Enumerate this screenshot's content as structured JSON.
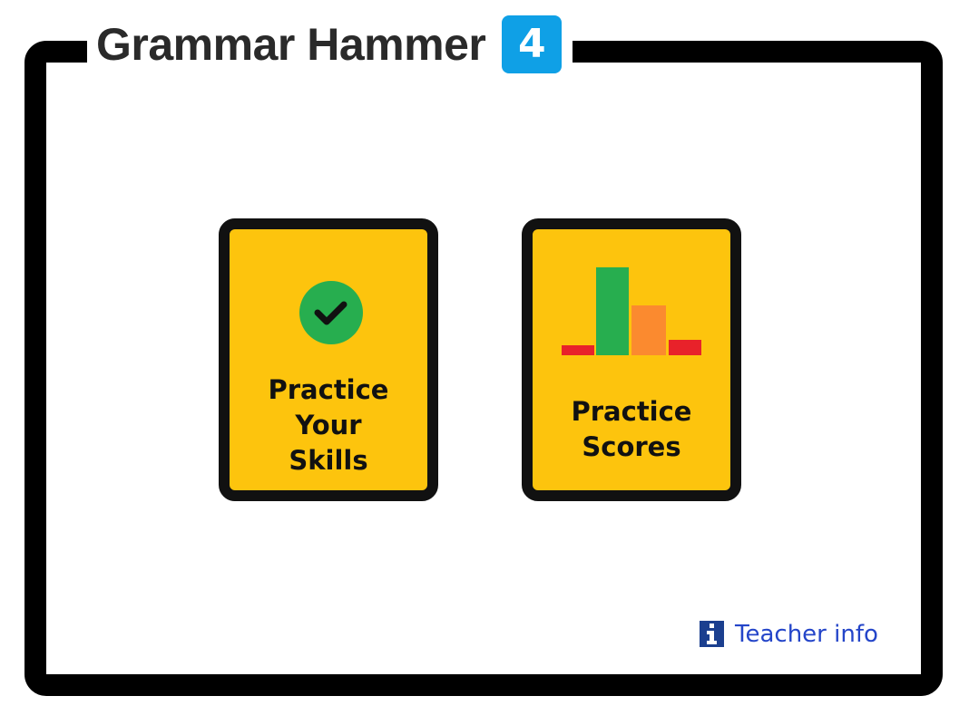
{
  "header": {
    "title": "Grammar Hammer",
    "level": "4"
  },
  "menu": {
    "practice_skills": {
      "label": "Practice\nYour\nSkills",
      "icon": "check-circle-icon"
    },
    "practice_scores": {
      "label": "Practice\nScores",
      "icon": "bar-chart-icon"
    }
  },
  "footer": {
    "teacher_info_label": "Teacher info",
    "icon": "info-icon"
  },
  "colors": {
    "card_fill": "#fdc40d",
    "card_border": "#111111",
    "frame": "#000000",
    "badge": "#0fa0e6",
    "check_circle": "#27ae4f",
    "link": "#2445c9",
    "bar_red": "#e8222a",
    "bar_green": "#27ae4f",
    "bar_orange": "#fb8a2f"
  }
}
